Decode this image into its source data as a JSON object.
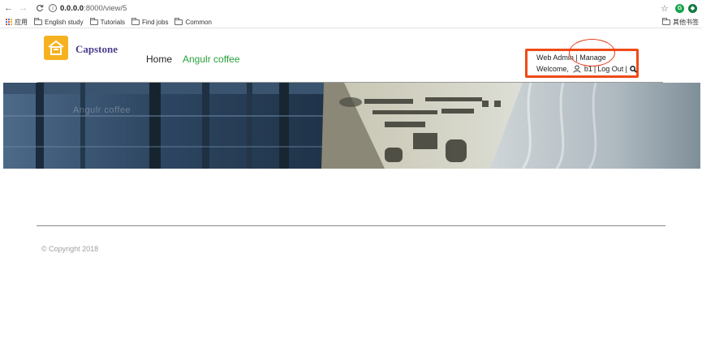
{
  "browser": {
    "url_info_glyph": "i",
    "url_host": "0.0.0.0",
    "url_path": ":8000/view/5",
    "star_glyph": "☆",
    "ext_1_letter": "G",
    "ext_2_letter": "◆",
    "back_glyph": "←",
    "forward_glyph": "→",
    "reload_glyph": "C"
  },
  "bookmarks": {
    "apps_label": "应用",
    "items": [
      "English study",
      "Tutorials",
      "Find jobs",
      "Common"
    ],
    "other_label": "其他书签"
  },
  "header": {
    "brand": "Capstone",
    "nav": [
      "Home",
      "Angulr coffee"
    ],
    "admin_label": "Web Admin",
    "separator": "|",
    "manage_label": "Manage",
    "welcome_label": "Welcome,",
    "username": "b1",
    "logout_label": "Log Out"
  },
  "banner": {
    "caption": "Angulr coffee"
  },
  "footer": {
    "copyright": "© Copyright 2018"
  },
  "colors": {
    "brand_text": "#4a3f8c",
    "nav_accent": "#2aa13b",
    "annotation": "#ef4b16",
    "logo": "#f5b120"
  },
  "icons": [
    "back-arrow-icon",
    "forward-arrow-icon",
    "reload-icon",
    "info-icon",
    "star-icon",
    "apps-icon",
    "folder-icon",
    "house-logo-icon",
    "user-icon",
    "search-icon"
  ]
}
